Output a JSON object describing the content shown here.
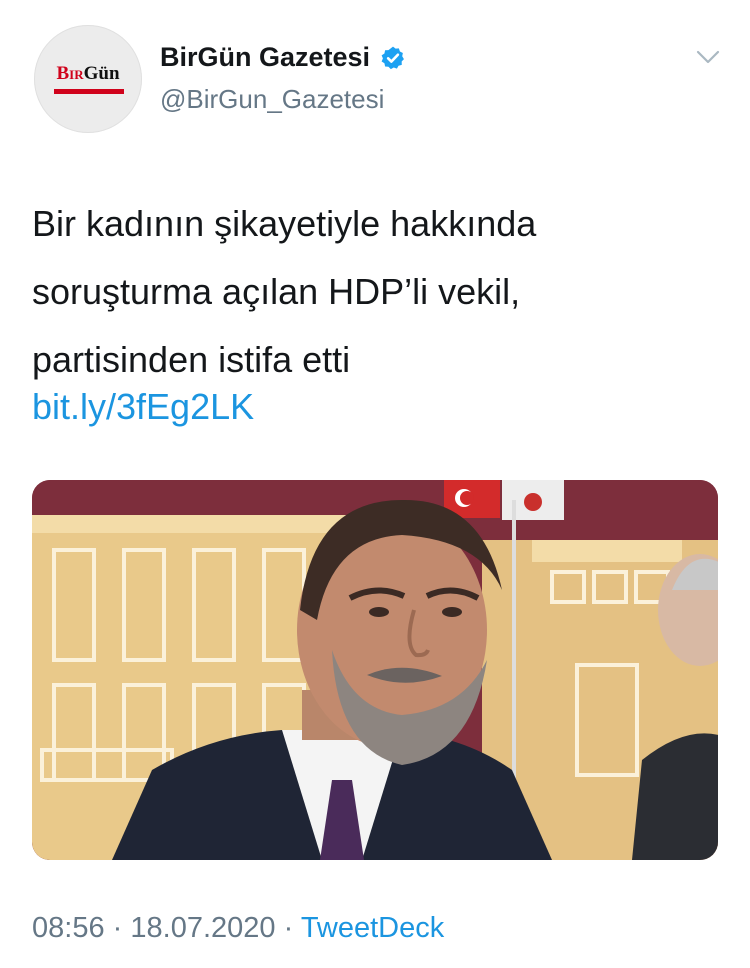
{
  "tweet": {
    "author": {
      "avatar_logo_bir": "Bir",
      "avatar_logo_gun": "Gün",
      "name": "BirGün Gazetesi",
      "handle": "@BirGun_Gazetesi",
      "verified": true
    },
    "text": "Bir kadının şikayetiyle hakkında\nsoruşturma açılan HDP’li vekil,\npartisinden istifa etti",
    "link": "bit.ly/3fEg2LK",
    "meta": {
      "time": "08:56",
      "separator": "·",
      "date": "18.07.2020",
      "source": "TweetDeck"
    },
    "colors": {
      "link": "#1b95e0",
      "muted": "#657786",
      "text": "#14171a",
      "verified": "#1da1f2"
    },
    "icons": [
      "verified-badge-icon",
      "chevron-down-icon"
    ]
  }
}
